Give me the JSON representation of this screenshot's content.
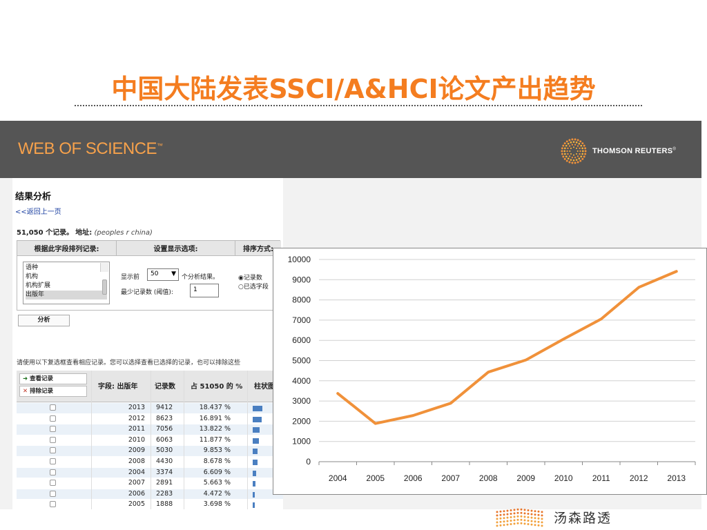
{
  "slide": {
    "title": "中国大陆发表SSCI/A&HCI论文产出趋势"
  },
  "header": {
    "wos_logo": "WEB OF SCIENCE",
    "wos_tm": "™",
    "tr_logo": "THOMSON REUTERS",
    "tr_tm": "®"
  },
  "analysis": {
    "title": "结果分析",
    "back_link": "<<返回上一页",
    "record_count": "51,050 个记录。",
    "address_label": "地址:",
    "address_value": "(peoples r china)",
    "col_rank_field": "根据此字段排列记录:",
    "col_display": "设置显示选项:",
    "col_sort": "排序方式:",
    "field_options": [
      "语种",
      "机构",
      "机构扩展",
      "出版年"
    ],
    "selected_field": "出版年",
    "show_top_label": "显示前",
    "show_top_value": "50",
    "show_top_suffix": "个分析结果。",
    "min_records_label": "最少记录数 (阈值):",
    "min_records_value": "1",
    "sort_by_records": "记录数",
    "sort_by_field": "已选字段",
    "analyze_button": "分析",
    "hint": "请使用以下复选框查看相应记录。您可以选择查看已选择的记录，也可以排除这些"
  },
  "table": {
    "view_records": "查看记录",
    "exclude_records": "排除记录",
    "col_field": "字段: 出版年",
    "col_count": "记录数",
    "col_pct": "占 51050 的 %",
    "col_bar": "柱状图",
    "rows": [
      {
        "year": "2013",
        "count": "9412",
        "pct": "18.437 %",
        "share": 18.437
      },
      {
        "year": "2012",
        "count": "8623",
        "pct": "16.891 %",
        "share": 16.891
      },
      {
        "year": "2011",
        "count": "7056",
        "pct": "13.822 %",
        "share": 13.822
      },
      {
        "year": "2010",
        "count": "6063",
        "pct": "11.877 %",
        "share": 11.877
      },
      {
        "year": "2009",
        "count": "5030",
        "pct": "9.853 %",
        "share": 9.853
      },
      {
        "year": "2008",
        "count": "4430",
        "pct": "8.678 %",
        "share": 8.678
      },
      {
        "year": "2004",
        "count": "3374",
        "pct": "6.609 %",
        "share": 6.609
      },
      {
        "year": "2007",
        "count": "2891",
        "pct": "5.663 %",
        "share": 5.663
      },
      {
        "year": "2006",
        "count": "2283",
        "pct": "4.472 %",
        "share": 4.472
      },
      {
        "year": "2005",
        "count": "1888",
        "pct": "3.698 %",
        "share": 3.698
      }
    ]
  },
  "chart_data": {
    "type": "line",
    "x": [
      "2004",
      "2005",
      "2006",
      "2007",
      "2008",
      "2009",
      "2010",
      "2011",
      "2012",
      "2013"
    ],
    "series": [
      {
        "values": [
          3374,
          1888,
          2283,
          2891,
          4430,
          5030,
          6063,
          7056,
          8623,
          9412
        ],
        "color": "#f0913a"
      }
    ],
    "ylim": [
      0,
      10000
    ],
    "yticks": [
      0,
      1000,
      2000,
      3000,
      4000,
      5000,
      6000,
      7000,
      8000,
      9000,
      10000
    ],
    "grid": true,
    "legend": "none"
  },
  "footer": {
    "brand_cn": "汤森路透"
  },
  "colors": {
    "title": "#f47d20",
    "header_bg": "#555555",
    "wos_orange": "#f6a14b",
    "bar_blue": "#4a7fc1",
    "line_orange": "#f0913a"
  }
}
